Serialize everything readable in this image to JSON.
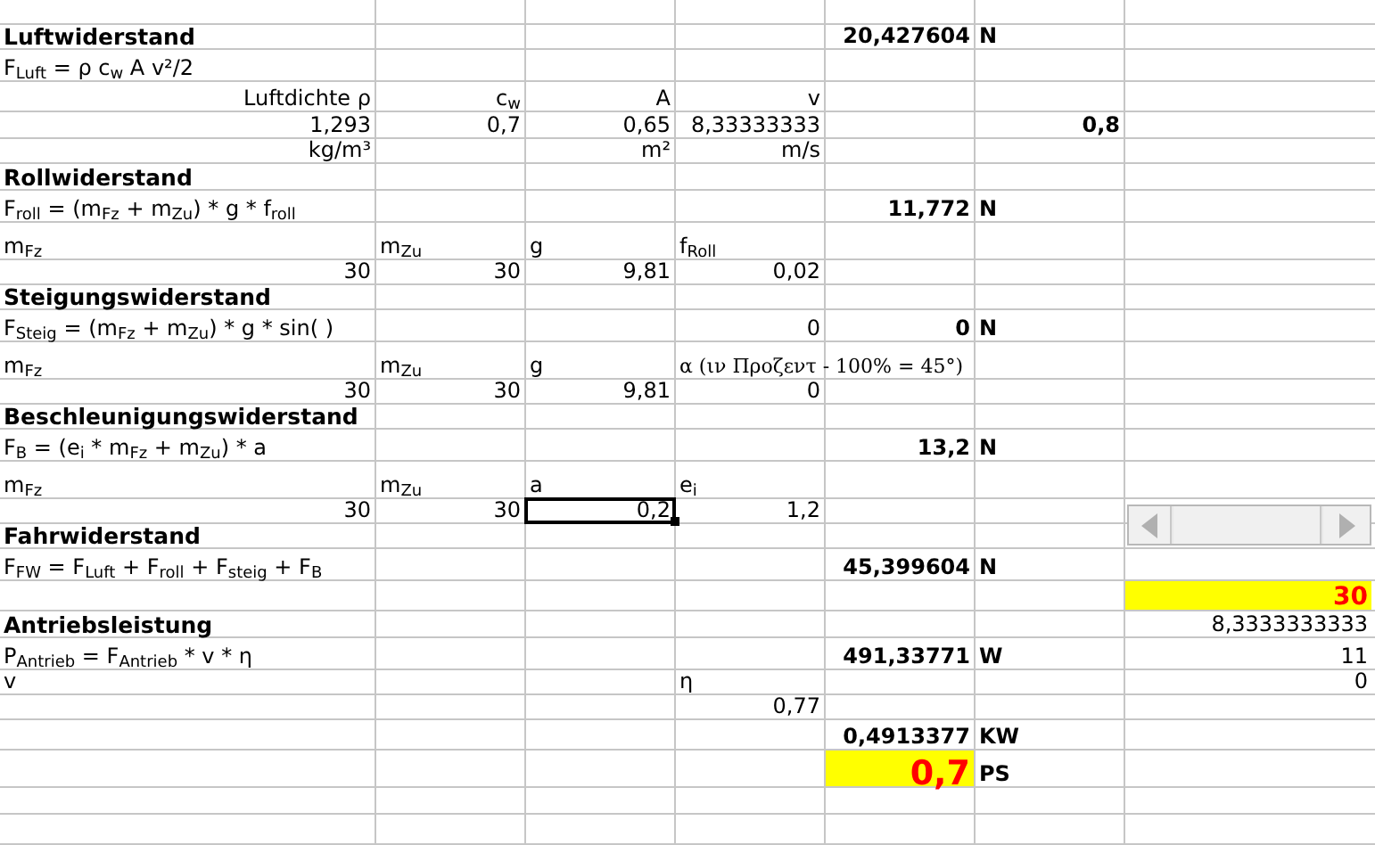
{
  "rows": [
    {},
    {
      "cells": {
        "col_1": {
          "kind": "title",
          "text": "Luftwiderstand",
          "selected": false
        },
        "col_5": {
          "kind": "result",
          "text": "20,427604",
          "selected": false
        },
        "col_6": {
          "kind": "unit",
          "text": "N",
          "selected": false
        }
      }
    },
    {
      "cells": {
        "col_1": {
          "kind": "formula",
          "text": "F$_{Luft}$ = ρ c$_{w}$ A v²/2",
          "selected": false
        }
      }
    },
    {
      "cells": {
        "col_1": {
          "kind": "caption",
          "text": "Luftdichte ρ",
          "selected": false
        },
        "col_2": {
          "kind": "caption",
          "text": "c$_{w}$",
          "selected": false
        },
        "col_3": {
          "kind": "caption",
          "text": "A",
          "selected": false
        },
        "col_4": {
          "kind": "caption",
          "text": "v",
          "selected": false
        }
      }
    },
    {
      "cells": {
        "col_1": {
          "kind": "value",
          "text": "1,293",
          "selected": false
        },
        "col_2": {
          "kind": "value",
          "text": "0,7",
          "selected": false
        },
        "col_3": {
          "kind": "value",
          "text": "0,65",
          "selected": false
        },
        "col_4": {
          "kind": "value",
          "text": "8,33333333",
          "selected": false
        },
        "col_6": {
          "kind": "result",
          "text": "0,8",
          "selected": false
        }
      }
    },
    {
      "cells": {
        "col_1": {
          "kind": "caption",
          "text": "kg/m³",
          "selected": false
        },
        "col_3": {
          "kind": "caption",
          "text": "m²",
          "selected": false
        },
        "col_4": {
          "kind": "caption",
          "text": "m/s",
          "selected": false
        }
      }
    },
    {
      "cells": {
        "col_1": {
          "kind": "title",
          "text": "Rollwiderstand",
          "selected": false
        }
      }
    },
    {
      "cells": {
        "col_1": {
          "kind": "formula",
          "text": "F$_{roll}$ = (m$_{Fz}$ + m$_{Zu}$) * g * f$_{roll}$",
          "selected": false
        },
        "col_5": {
          "kind": "result",
          "text": "11,772",
          "selected": false
        },
        "col_6": {
          "kind": "unit",
          "text": "N",
          "selected": false
        }
      }
    },
    {
      "cells": {
        "col_1": {
          "kind": "symbol",
          "text": "m$_{Fz}$",
          "selected": false
        },
        "col_2": {
          "kind": "symbol",
          "text": "m$_{Zu}$",
          "selected": false
        },
        "col_3": {
          "kind": "symbol",
          "text": "g",
          "selected": false
        },
        "col_4": {
          "kind": "symbol",
          "text": "f$_{Roll}$",
          "selected": false
        }
      }
    },
    {
      "cells": {
        "col_1": {
          "kind": "value",
          "text": "30",
          "selected": false
        },
        "col_2": {
          "kind": "value",
          "text": "30",
          "selected": false
        },
        "col_3": {
          "kind": "value",
          "text": "9,81",
          "selected": false
        },
        "col_4": {
          "kind": "value",
          "text": "0,02",
          "selected": false
        }
      }
    },
    {
      "cells": {
        "col_1": {
          "kind": "title",
          "text": "Steigungswiderstand",
          "selected": false
        }
      }
    },
    {
      "cells": {
        "col_1": {
          "kind": "formula",
          "text": "F$_{Steig}$ = (m$_{Fz}$ + m$_{Zu}$) * g * sin( )",
          "selected": false
        },
        "col_4": {
          "kind": "value",
          "text": "0",
          "selected": false
        },
        "col_5": {
          "kind": "result",
          "text": "0",
          "selected": false
        },
        "col_6": {
          "kind": "unit",
          "text": "N",
          "selected": false
        }
      }
    },
    {
      "cells": {
        "col_1": {
          "kind": "symbol",
          "text": "m$_{Fz}$",
          "selected": false
        },
        "col_2": {
          "kind": "symbol",
          "text": "m$_{Zu}$",
          "selected": false
        },
        "col_3": {
          "kind": "symbol",
          "text": "g",
          "selected": false
        },
        "col_4": {
          "kind": "note",
          "text": "α (ιν Προζεντ - 100% = 45°)",
          "selected": false
        }
      }
    },
    {
      "cells": {
        "col_1": {
          "kind": "value",
          "text": "30",
          "selected": false
        },
        "col_2": {
          "kind": "value",
          "text": "30",
          "selected": false
        },
        "col_3": {
          "kind": "value",
          "text": "9,81",
          "selected": false
        },
        "col_4": {
          "kind": "value",
          "text": "0",
          "selected": false
        }
      }
    },
    {
      "cells": {
        "col_1": {
          "kind": "title",
          "text": "Beschleunigungswiderstand",
          "selected": false
        }
      }
    },
    {
      "cells": {
        "col_1": {
          "kind": "formula",
          "text": "F$_{B}$ = (e$_{i}$ * m$_{Fz}$ + m$_{Zu}$) * a",
          "selected": false
        },
        "col_5": {
          "kind": "result",
          "text": "13,2",
          "selected": false
        },
        "col_6": {
          "kind": "unit",
          "text": "N",
          "selected": false
        }
      }
    },
    {
      "cells": {
        "col_1": {
          "kind": "symbol",
          "text": "m$_{Fz}$",
          "selected": false
        },
        "col_2": {
          "kind": "symbol",
          "text": "m$_{Zu}$",
          "selected": false
        },
        "col_3": {
          "kind": "symbol",
          "text": "a",
          "selected": false
        },
        "col_4": {
          "kind": "symbol",
          "text": "e$_{i}$",
          "selected": false
        }
      }
    },
    {
      "cells": {
        "col_1": {
          "kind": "value",
          "text": "30",
          "selected": false
        },
        "col_2": {
          "kind": "value",
          "text": "30",
          "selected": false
        },
        "col_3": {
          "kind": "value",
          "text": "0,2",
          "selected": true
        },
        "col_4": {
          "kind": "value",
          "text": "1,2",
          "selected": false
        }
      }
    },
    {
      "cells": {
        "col_1": {
          "kind": "title",
          "text": "Fahrwiderstand",
          "selected": false
        }
      }
    },
    {
      "cells": {
        "col_1": {
          "kind": "formula",
          "text": "F$_{FW}$ = F$_{Luft}$ + F$_{roll}$ + F$_{steig}$ + F$_{B}$",
          "selected": false
        },
        "col_5": {
          "kind": "result",
          "text": "45,399604",
          "selected": false
        },
        "col_6": {
          "kind": "unit",
          "text": "N",
          "selected": false
        }
      }
    },
    {
      "cells": {
        "col_7": {
          "kind": "highlight",
          "text": "30",
          "selected": false
        }
      }
    },
    {
      "cells": {
        "col_1": {
          "kind": "title",
          "text": "Antriebsleistung",
          "selected": false
        },
        "col_7": {
          "kind": "value",
          "text": "8,3333333333",
          "selected": false
        }
      }
    },
    {
      "cells": {
        "col_1": {
          "kind": "formula",
          "text": "P$_{Antrieb}$ = F$_{Antrieb}$ * v * η",
          "selected": false
        },
        "col_5": {
          "kind": "result",
          "text": "491,33771",
          "selected": false
        },
        "col_6": {
          "kind": "unit",
          "text": "W",
          "selected": false
        },
        "col_7": {
          "kind": "value",
          "text": "11",
          "selected": false
        }
      }
    },
    {
      "cells": {
        "col_1": {
          "kind": "symbol",
          "text": "v",
          "selected": false
        },
        "col_4": {
          "kind": "symbol",
          "text": "η",
          "selected": false
        },
        "col_7": {
          "kind": "value",
          "text": "0",
          "selected": false
        }
      }
    },
    {
      "cells": {
        "col_4": {
          "kind": "value",
          "text": "0,77",
          "selected": false
        }
      }
    },
    {
      "cells": {
        "col_5": {
          "kind": "result",
          "text": "0,4913377",
          "selected": false
        },
        "col_6": {
          "kind": "unit",
          "text": "KW",
          "selected": false
        }
      }
    },
    {
      "cells": {
        "col_5": {
          "kind": "highlight_large",
          "text": "0,7",
          "selected": false
        },
        "col_6": {
          "kind": "unit",
          "text": "PS",
          "selected": false
        }
      }
    },
    {},
    {}
  ]
}
